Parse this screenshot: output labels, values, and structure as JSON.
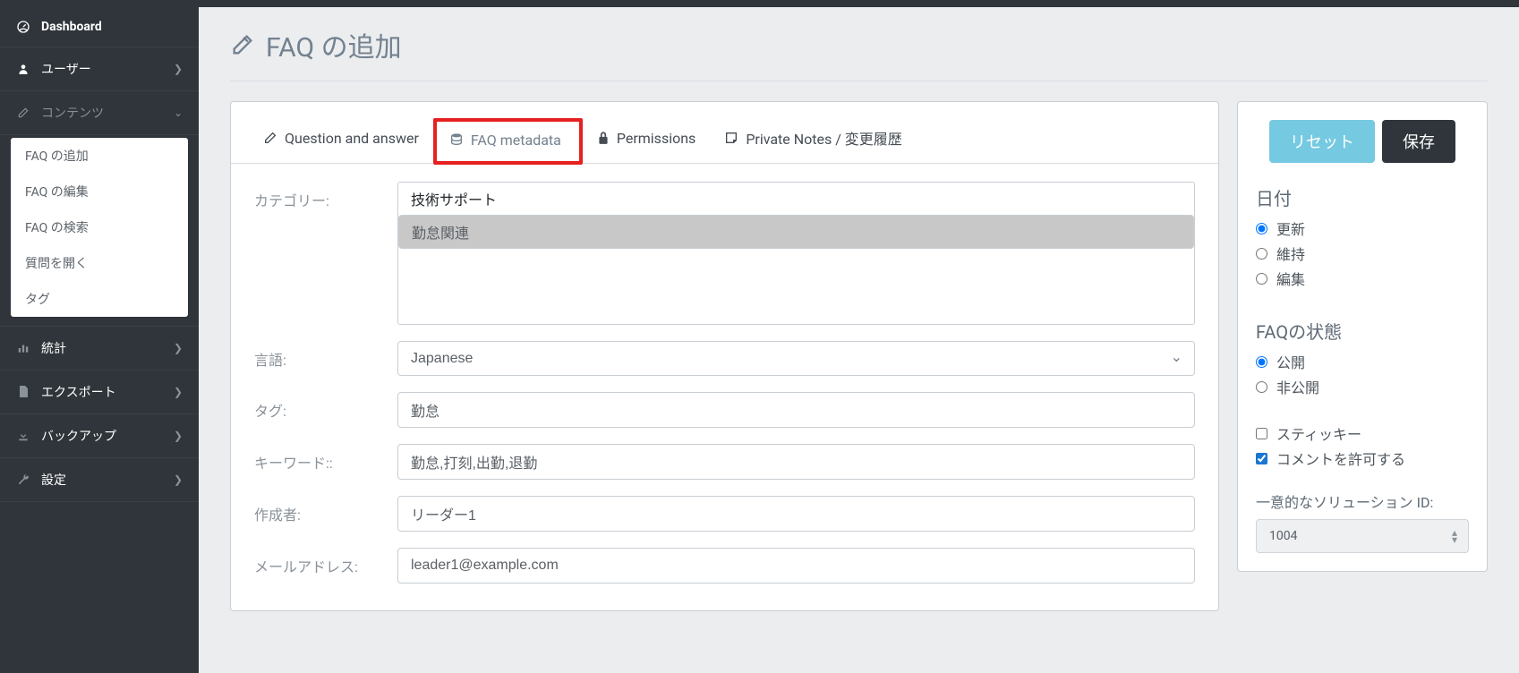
{
  "sidebar": {
    "dashboard": "Dashboard",
    "users": "ユーザー",
    "contents": "コンテンツ",
    "sub_add": "FAQ の追加",
    "sub_edit": "FAQ の編集",
    "sub_search": "FAQ の検索",
    "sub_open": "質問を開く",
    "sub_tag": "タグ",
    "stats": "統計",
    "export": "エクスポート",
    "backup": "バックアップ",
    "settings": "設定"
  },
  "page": {
    "title": "FAQ の追加"
  },
  "tabs": {
    "qa": "Question and answer",
    "metadata": "FAQ metadata",
    "permissions": "Permissions",
    "notes": "Private Notes / 変更履歴"
  },
  "labels": {
    "category": "カテゴリー:",
    "language": "言語:",
    "tag": "タグ:",
    "keywords": "キーワード::",
    "author": "作成者:",
    "email": "メールアドレス:"
  },
  "form": {
    "cat_tech": "技術サポート",
    "cat_kintai": "勤怠関連",
    "language": "Japanese",
    "tag": "勤怠",
    "keywords": "勤怠,打刻,出勤,退勤",
    "author": "リーダー1",
    "email": "leader1@example.com"
  },
  "rightpane": {
    "reset": "リセット",
    "save": "保存",
    "date": "日付",
    "date_update": "更新",
    "date_keep": "維持",
    "date_edit": "編集",
    "status": "FAQの状態",
    "status_pub": "公開",
    "status_priv": "非公開",
    "sticky": "スティッキー",
    "allow_comments": "コメントを許可する",
    "solution_id_label": "一意的なソリューション ID:",
    "solution_id": "1004"
  }
}
